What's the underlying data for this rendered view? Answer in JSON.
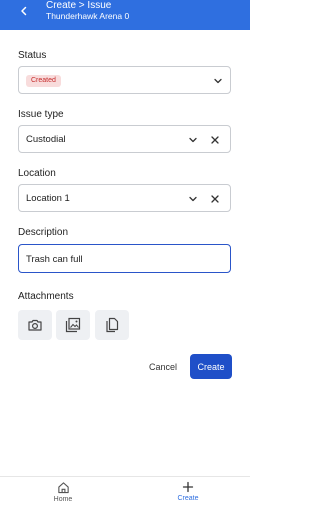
{
  "header": {
    "title": "Create > Issue",
    "subtitle": "Thunderhawk Arena 0",
    "back_icon": "chevron-left-icon"
  },
  "form": {
    "status": {
      "label": "Status",
      "value": "Created",
      "badge_bg": "#f8dcdc",
      "badge_color": "#c62b2b"
    },
    "issue_type": {
      "label": "Issue type",
      "value": "Custodial"
    },
    "location": {
      "label": "Location",
      "value": "Location 1"
    },
    "description": {
      "label": "Description",
      "value": "Trash can full"
    },
    "attachments": {
      "label": "Attachments",
      "buttons": [
        "camera-icon",
        "image-gallery-icon",
        "copy-document-icon"
      ]
    }
  },
  "actions": {
    "cancel_label": "Cancel",
    "create_label": "Create"
  },
  "bottom_nav": {
    "items": [
      {
        "label": "Home",
        "icon": "home-icon"
      },
      {
        "label": "Create",
        "icon": "plus-icon"
      }
    ]
  },
  "colors": {
    "primary": "#2f6fe0",
    "button": "#1f4fc8",
    "focus_border": "#2a55c9"
  }
}
